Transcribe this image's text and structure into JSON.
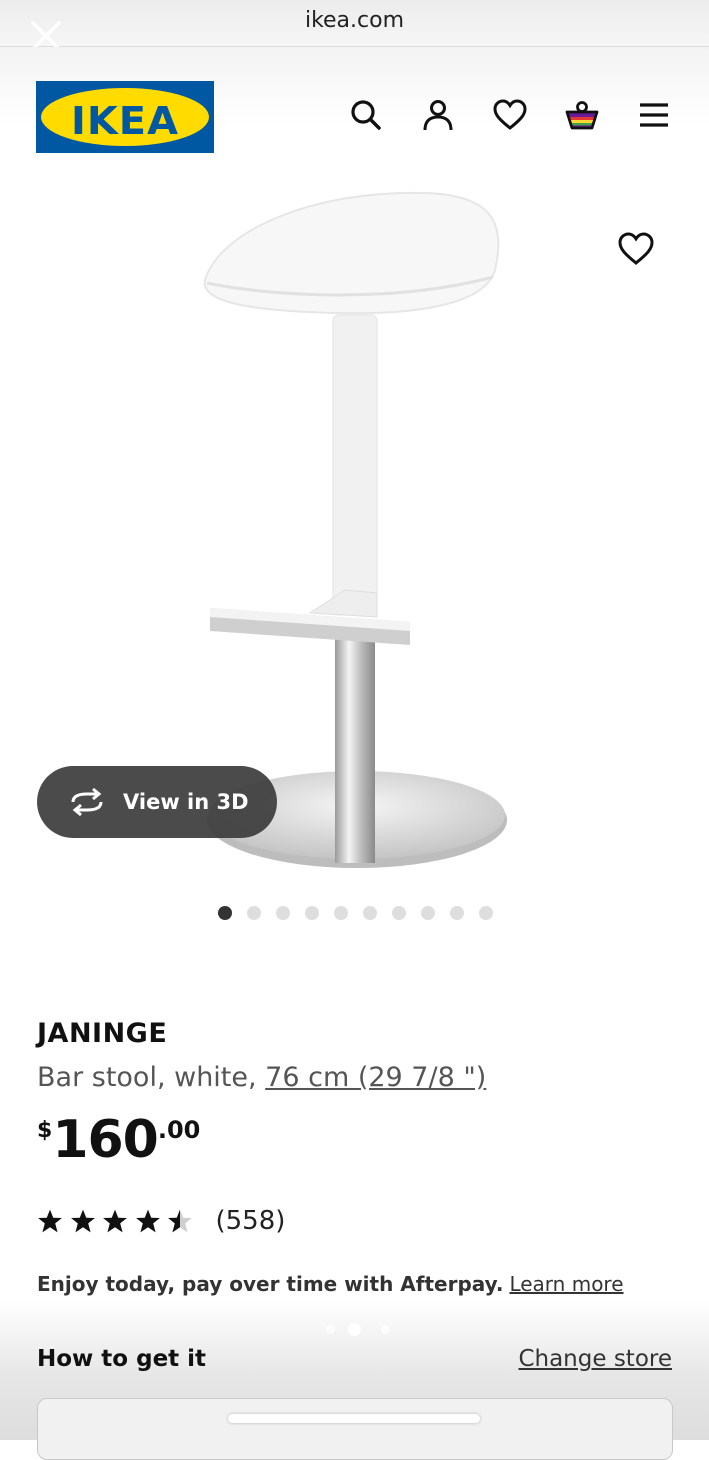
{
  "browser": {
    "url": "ikea.com"
  },
  "header": {
    "logo_text": "IKEA",
    "brand_colors": {
      "blue": "#0058a3",
      "yellow": "#ffdb00"
    },
    "icons": [
      "search-icon",
      "account-icon",
      "favourites-icon",
      "cart-icon",
      "menu-icon"
    ]
  },
  "gallery": {
    "view3d_label": "View in 3D",
    "image_count": 10,
    "active_index": 0
  },
  "product": {
    "name": "JANINGE",
    "description": "Bar stool, white, ",
    "size": "76 cm (29 7/8 \")",
    "price": {
      "currency": "$",
      "main": "160",
      "cents": ".00"
    },
    "rating": {
      "value": 4.5,
      "max": 5,
      "count": "(558)"
    },
    "afterpay_text": "Enjoy today, pay over time with Afterpay.",
    "afterpay_link": "Learn more"
  },
  "availability": {
    "title": "How to get it",
    "change_store": "Change store"
  }
}
